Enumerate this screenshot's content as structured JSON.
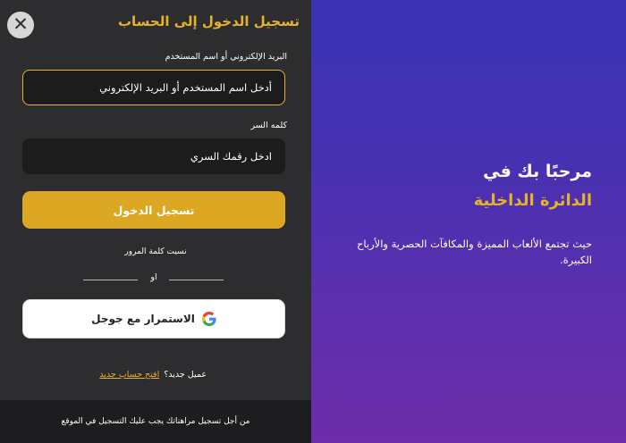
{
  "login": {
    "title": "تسجيل الدخول إلى الحساب",
    "close_icon": "close-icon",
    "email_label": "البريد الإلكتروني أو اسم المستخدم",
    "email_placeholder": "أدخل اسم المستخدم أو البريد الإلكتروني",
    "password_label": "كلمه السر",
    "password_placeholder": "ادخل رقمك السري",
    "login_button": "تسجيل الدخول",
    "forgot_password": "نسيت كلمة المرور",
    "or_text": "او",
    "google_button": "الاستمرار مع جوجل",
    "google_icon": "google-icon",
    "new_customer": "عميل جديد؟",
    "create_account": "افتح حساب جديد",
    "footer_note": "من أجل تسجيل مراهناتك يجب عليك التسجيل في الموقع"
  },
  "welcome": {
    "heading": "مرحبًا بك في",
    "name": "الدائرة الداخلية",
    "description": "حيث تجتمع الألعاب المميزة والمكافآت الحصرية والأرباح الكبيرة."
  },
  "colors": {
    "accent": "#e5b22a",
    "panel_bg": "#2d2d2f",
    "field_bg": "#1c1c1c",
    "gradient_start": "#3a33b5",
    "gradient_end": "#6e2da9"
  }
}
